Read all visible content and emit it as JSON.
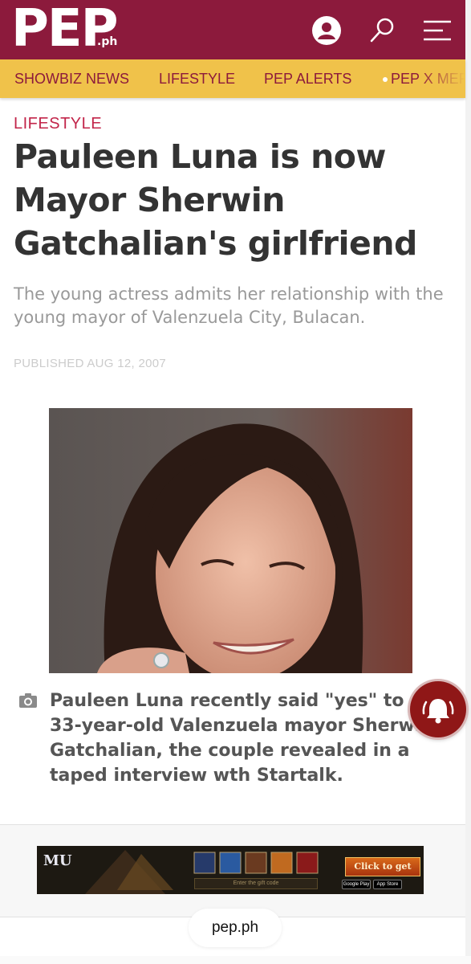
{
  "header": {
    "logo_text": "PEP",
    "logo_suffix": ".ph",
    "brand_color": "#8c1a3c",
    "icons": [
      "user-icon",
      "search-icon",
      "menu-icon"
    ]
  },
  "nav": {
    "items": [
      "SHOWBIZ NEWS",
      "LIFESTYLE",
      "PEP ALERTS",
      "PEP X MERCH"
    ],
    "background": "#f0c24a"
  },
  "article": {
    "section": "LIFESTYLE",
    "headline": "Pauleen Luna is now Mayor Sherwin Gatchalian's girlfriend",
    "dek": "The young actress admits her relationship with the young mayor of Valenzuela City, Bulacan.",
    "published": "PUBLISHED AUG 12, 2007",
    "caption": "Pauleen Luna recently said \"yes\" to 33-year-old Valenzuela mayor Sherwin Gatchalian, the couple revealed in a taped interview wth Startalk."
  },
  "ad": {
    "logo": "MU",
    "input_placeholder": "Enter the gift code",
    "cta": "Click to get",
    "stores": [
      "Google Play",
      "App Store"
    ]
  },
  "footer": {
    "url": "pep.ph"
  }
}
